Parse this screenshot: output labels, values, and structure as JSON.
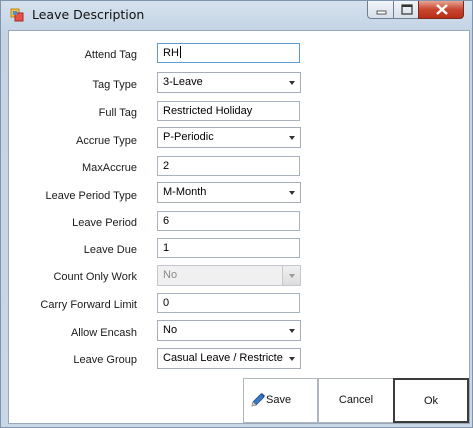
{
  "window": {
    "title": "Leave Description"
  },
  "form": {
    "attend_tag": {
      "label": "Attend Tag",
      "value": "RH"
    },
    "tag_type": {
      "label": "Tag Type",
      "value": "3-Leave"
    },
    "full_tag": {
      "label": "Full Tag",
      "value": "Restricted Holiday"
    },
    "accrue_type": {
      "label": "Accrue Type",
      "value": "P-Periodic"
    },
    "max_accrue": {
      "label": "MaxAccrue",
      "value": "2"
    },
    "leave_period_type": {
      "label": "Leave Period Type",
      "value": "M-Month"
    },
    "leave_period": {
      "label": "Leave Period",
      "value": "6"
    },
    "leave_due": {
      "label": "Leave Due",
      "value": "1"
    },
    "count_only_work": {
      "label": "Count Only Work",
      "value": "No"
    },
    "carry_forward_limit": {
      "label": "Carry Forward Limit",
      "value": "0"
    },
    "allow_encash": {
      "label": "Allow Encash",
      "value": "No"
    },
    "leave_group": {
      "label": "Leave Group",
      "value": "Casual Leave / Restricte"
    }
  },
  "buttons": {
    "save": "Save",
    "cancel": "Cancel",
    "ok": "Ok"
  },
  "icons": {
    "app": "app-form-icon",
    "save": "pencil-icon"
  }
}
